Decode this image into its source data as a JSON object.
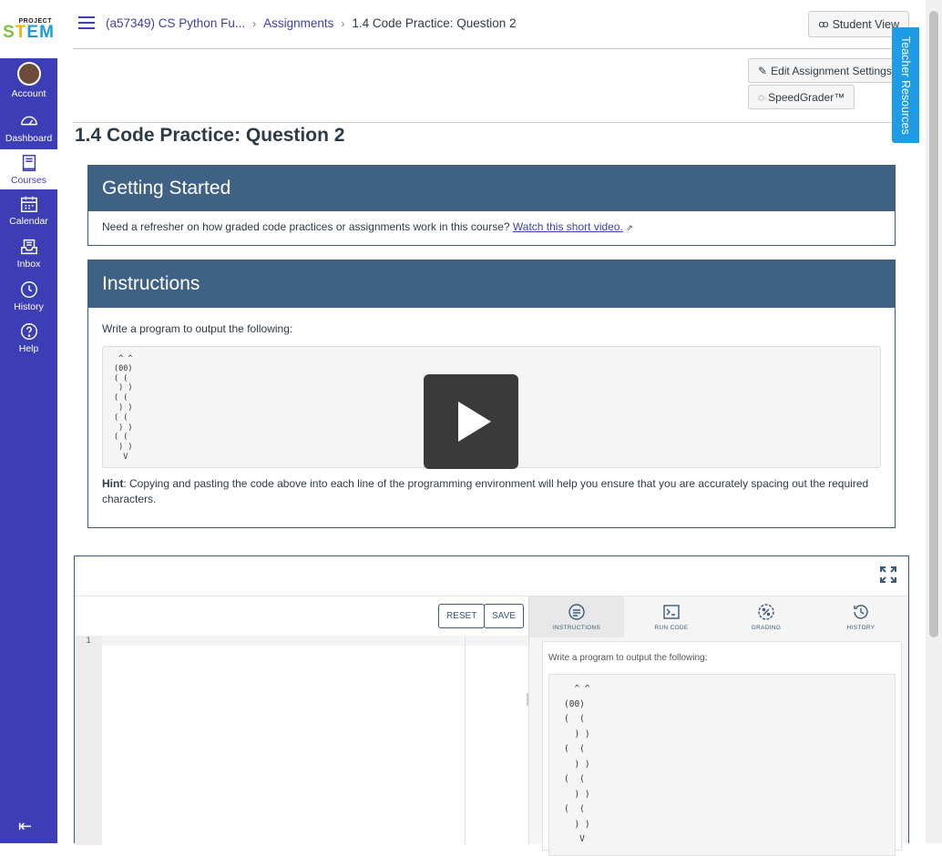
{
  "logo": {
    "project": "PROJECT",
    "stem": [
      "S",
      "T",
      "E",
      "M"
    ]
  },
  "nav": {
    "account": "Account",
    "dashboard": "Dashboard",
    "courses": "Courses",
    "calendar": "Calendar",
    "inbox": "Inbox",
    "history": "History",
    "help": "Help"
  },
  "breadcrumb": {
    "course": "(a57349) CS Python Fu...",
    "assignments": "Assignments",
    "current": "1.4 Code Practice: Question 2"
  },
  "buttons": {
    "student_view": "Student View",
    "edit_settings": "Edit Assignment Settings",
    "speedgrader": "SpeedGrader™",
    "teacher_resources": "Teacher Resources"
  },
  "page_title": "1.4 Code Practice: Question 2",
  "getting_started": {
    "title": "Getting Started",
    "text": "Need a refresher on how graded code practices or assignments work in this course?",
    "link": "Watch this short video."
  },
  "instructions": {
    "title": "Instructions",
    "prompt": "Write a program to output the following:",
    "code": " ^ ^\n(00)\n( (\n ) )\n( (\n ) )\n( (\n ) )\n( (\n ) )\n  V",
    "hint_label": "Hint",
    "hint_text": ": Copying and pasting the code above into each line of the programming environment will help you ensure that you are accurately spacing out the required characters."
  },
  "editor": {
    "reset": "RESET",
    "save": "SAVE",
    "line_number": "1",
    "tabs": [
      "INSTRUCTIONS",
      "RUN CODE",
      "GRADING",
      "HISTORY"
    ],
    "panel_prompt": "Write a program to output the following:",
    "panel_code": "  ^ ^\n(00)\n(  (\n  ) )\n(  (\n  ) )\n(  (\n  ) )\n(  (\n  ) )\n   V"
  }
}
